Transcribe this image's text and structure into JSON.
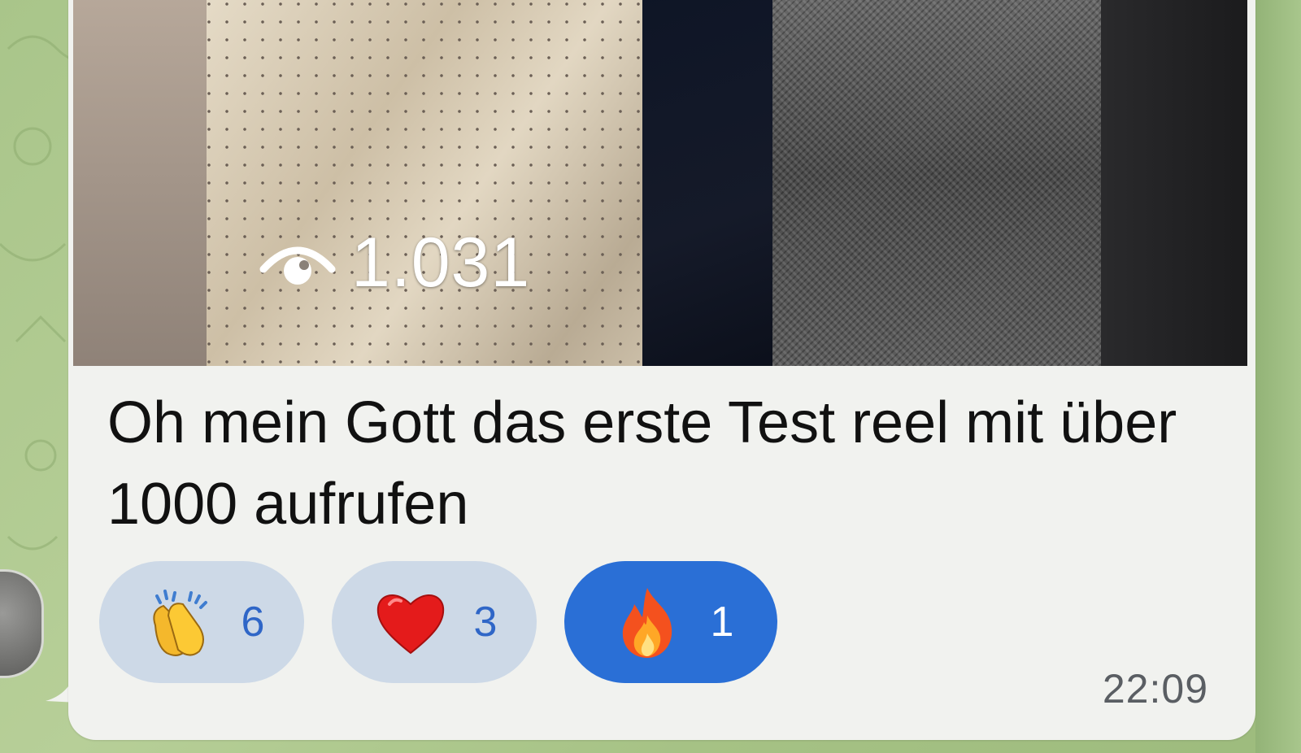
{
  "message": {
    "video": {
      "views_count": "1.031",
      "views_icon": "eye-icon"
    },
    "caption": "Oh mein Gott das erste Test reel mit über 1000 aufrufen",
    "time": "22:09",
    "reactions": [
      {
        "emoji": "clapping-hands-emoji",
        "count": "6",
        "active": false
      },
      {
        "emoji": "red-heart-emoji",
        "count": "3",
        "active": false
      },
      {
        "emoji": "fire-emoji",
        "count": "1",
        "active": true
      }
    ]
  },
  "colors": {
    "chat_background": "#a9c58a",
    "bubble": "#f1f2ef",
    "reaction_inactive": "#cdd9e7",
    "reaction_active": "#2a6fd6",
    "reaction_count": "#2f66c7",
    "time_text": "#5a5e63"
  }
}
